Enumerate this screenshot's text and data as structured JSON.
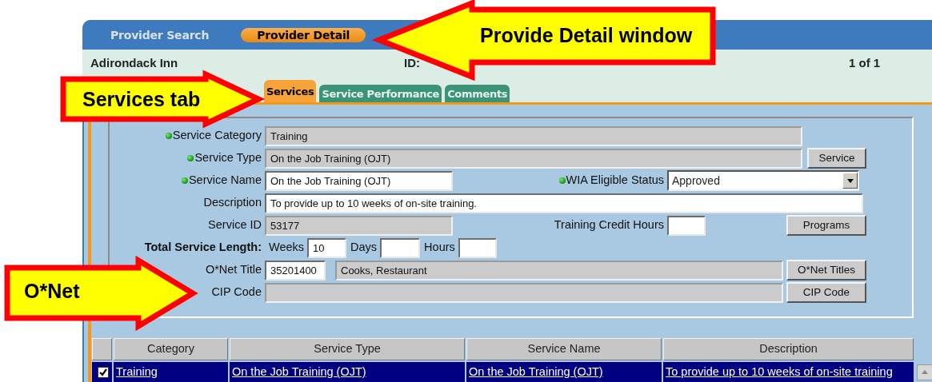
{
  "header_tabs": [
    {
      "label": "Provider Search",
      "selected": false
    },
    {
      "label": "Provider Detail",
      "selected": true
    }
  ],
  "provider": {
    "name": "Adirondack Inn",
    "id_label": "ID:",
    "record_count": "1 of 1"
  },
  "detail_tabs": [
    {
      "label": "Services",
      "selected": true
    },
    {
      "label": "Service Performance",
      "selected": false
    },
    {
      "label": "Comments",
      "selected": false
    }
  ],
  "form": {
    "rows": [
      {
        "items": [
          {
            "kind": "label",
            "text": "Service Category",
            "required": true
          },
          {
            "kind": "field",
            "value": "Training",
            "readonly": true
          }
        ]
      },
      {
        "items": [
          {
            "kind": "label",
            "text": "Service Type",
            "required": true
          },
          {
            "kind": "field",
            "value": "On the Job Training (OJT)",
            "readonly": true
          },
          {
            "kind": "button",
            "text": "Service"
          }
        ]
      },
      {
        "items": [
          {
            "kind": "label",
            "text": "Service Name",
            "required": true
          },
          {
            "kind": "field",
            "value": "On the Job Training (OJT)",
            "readonly": false
          },
          {
            "kind": "label",
            "text": "WIA Eligible Status",
            "required": true
          },
          {
            "kind": "select",
            "value": "Approved"
          }
        ]
      },
      {
        "items": [
          {
            "kind": "label",
            "text": "Description",
            "required": false
          },
          {
            "kind": "field",
            "value": "To provide up to 10 weeks of on-site training.",
            "readonly": false
          }
        ]
      },
      {
        "items": [
          {
            "kind": "label",
            "text": "Service ID",
            "required": false
          },
          {
            "kind": "field",
            "value": "53177",
            "readonly": true
          },
          {
            "kind": "label",
            "text": "Training Credit Hours",
            "required": false
          },
          {
            "kind": "field",
            "readonly": false
          },
          {
            "kind": "button",
            "text": "Programs"
          }
        ]
      },
      {
        "items": [
          {
            "kind": "section_label",
            "text": "Total Service Length:"
          },
          {
            "kind": "label",
            "text": "Weeks",
            "required": false
          },
          {
            "kind": "field",
            "value": "10",
            "readonly": false
          },
          {
            "kind": "label",
            "text": "Days",
            "required": false
          },
          {
            "kind": "field",
            "readonly": false
          },
          {
            "kind": "label",
            "text": "Hours",
            "required": false
          },
          {
            "kind": "field",
            "readonly": false
          }
        ]
      },
      {
        "items": [
          {
            "kind": "label",
            "text": "O*Net Title",
            "required": false
          },
          {
            "kind": "field",
            "value": "35201400",
            "readonly": false
          },
          {
            "kind": "field",
            "value": "Cooks, Restaurant",
            "readonly": true
          },
          {
            "kind": "button",
            "text": "O*Net Titles"
          }
        ]
      },
      {
        "items": [
          {
            "kind": "label",
            "text": "CIP Code",
            "required": false
          },
          {
            "kind": "field",
            "readonly": true
          },
          {
            "kind": "button",
            "text": "CIP Code"
          }
        ]
      }
    ]
  },
  "table": {
    "columns": [
      "Category",
      "Service Type",
      "Service Name",
      "Description"
    ],
    "rows": [
      {
        "checked": true,
        "selected": true,
        "cells": [
          "Training",
          "On the Job Training (OJT)",
          "On the Job Training (OJT)",
          "To provide up to 10 weeks of on-site training"
        ]
      }
    ]
  },
  "callouts": [
    {
      "text": "Provide Detail window",
      "kind": "arrow_left"
    },
    {
      "text": "Services tab",
      "kind": "arrow_right"
    },
    {
      "text": "O*Net",
      "kind": "arrow_right"
    }
  ]
}
